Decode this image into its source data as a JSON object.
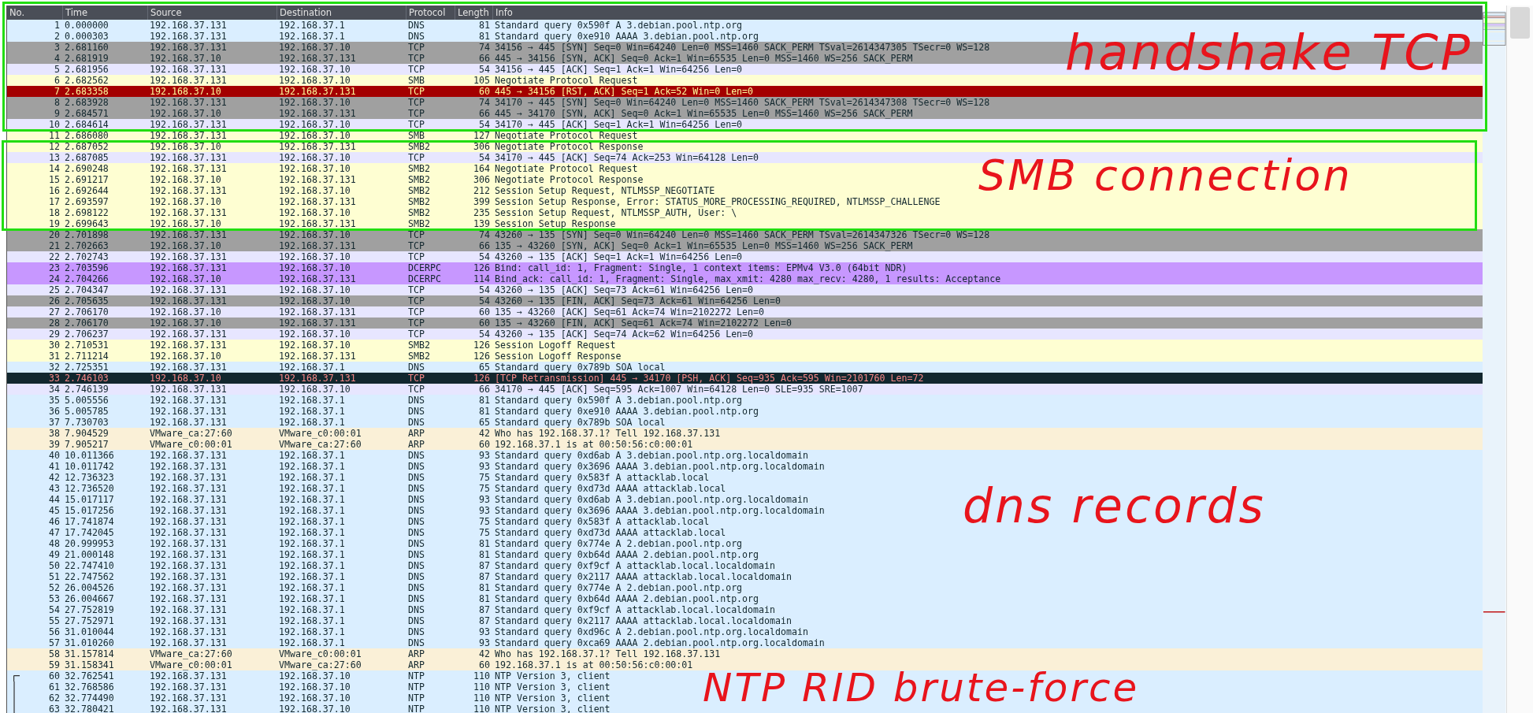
{
  "columns": [
    "No.",
    "Time",
    "Source",
    "Destination",
    "Protocol",
    "Length",
    "Info"
  ],
  "packets": [
    {
      "no": "1",
      "time": "0.000000",
      "source": "192.168.37.131",
      "destination": "192.168.37.1",
      "protocol": "DNS",
      "length": "81",
      "info": "Standard query 0x590f A 3.debian.pool.ntp.org",
      "kind": "udp",
      "related": false
    },
    {
      "no": "2",
      "time": "0.000303",
      "source": "192.168.37.131",
      "destination": "192.168.37.1",
      "protocol": "DNS",
      "length": "81",
      "info": "Standard query 0xe910 AAAA 3.debian.pool.ntp.org",
      "kind": "udp",
      "related": false
    },
    {
      "no": "3",
      "time": "2.681160",
      "source": "192.168.37.131",
      "destination": "192.168.37.10",
      "protocol": "TCP",
      "length": "74",
      "info": "34156 → 445 [SYN] Seq=0 Win=64240 Len=0 MSS=1460 SACK_PERM TSval=2614347305 TSecr=0 WS=128",
      "kind": "synfin",
      "related": false
    },
    {
      "no": "4",
      "time": "2.681919",
      "source": "192.168.37.10",
      "destination": "192.168.37.131",
      "protocol": "TCP",
      "length": "66",
      "info": "445 → 34156 [SYN, ACK] Seq=0 Ack=1 Win=65535 Len=0 MSS=1460 WS=256 SACK_PERM",
      "kind": "synfin",
      "related": false
    },
    {
      "no": "5",
      "time": "2.681956",
      "source": "192.168.37.131",
      "destination": "192.168.37.10",
      "protocol": "TCP",
      "length": "54",
      "info": "34156 → 445 [ACK] Seq=1 Ack=1 Win=64256 Len=0",
      "kind": "tcp",
      "related": false
    },
    {
      "no": "6",
      "time": "2.682562",
      "source": "192.168.37.131",
      "destination": "192.168.37.10",
      "protocol": "SMB",
      "length": "105",
      "info": "Negotiate Protocol Request",
      "kind": "smb",
      "related": false
    },
    {
      "no": "7",
      "time": "2.683358",
      "source": "192.168.37.10",
      "destination": "192.168.37.131",
      "protocol": "TCP",
      "length": "60",
      "info": "445 → 34156 [RST, ACK] Seq=1 Ack=52 Win=0 Len=0",
      "kind": "reset",
      "related": false
    },
    {
      "no": "8",
      "time": "2.683928",
      "source": "192.168.37.131",
      "destination": "192.168.37.10",
      "protocol": "TCP",
      "length": "74",
      "info": "34170 → 445 [SYN] Seq=0 Win=64240 Len=0 MSS=1460 SACK_PERM TSval=2614347308 TSecr=0 WS=128",
      "kind": "synfin",
      "related": false
    },
    {
      "no": "9",
      "time": "2.684571",
      "source": "192.168.37.10",
      "destination": "192.168.37.131",
      "protocol": "TCP",
      "length": "66",
      "info": "445 → 34170 [SYN, ACK] Seq=0 Ack=1 Win=65535 Len=0 MSS=1460 WS=256 SACK_PERM",
      "kind": "synfin",
      "related": false
    },
    {
      "no": "10",
      "time": "2.684614",
      "source": "192.168.37.131",
      "destination": "192.168.37.10",
      "protocol": "TCP",
      "length": "54",
      "info": "34170 → 445 [ACK] Seq=1 Ack=1 Win=64256 Len=0",
      "kind": "tcp",
      "related": false
    },
    {
      "no": "11",
      "time": "2.686080",
      "source": "192.168.37.131",
      "destination": "192.168.37.10",
      "protocol": "SMB",
      "length": "127",
      "info": "Negotiate Protocol Request",
      "kind": "smb",
      "related": false
    },
    {
      "no": "12",
      "time": "2.687052",
      "source": "192.168.37.10",
      "destination": "192.168.37.131",
      "protocol": "SMB2",
      "length": "306",
      "info": "Negotiate Protocol Response",
      "kind": "smb",
      "related": false
    },
    {
      "no": "13",
      "time": "2.687085",
      "source": "192.168.37.131",
      "destination": "192.168.37.10",
      "protocol": "TCP",
      "length": "54",
      "info": "34170 → 445 [ACK] Seq=74 Ack=253 Win=64128 Len=0",
      "kind": "tcp",
      "related": false
    },
    {
      "no": "14",
      "time": "2.690248",
      "source": "192.168.37.131",
      "destination": "192.168.37.10",
      "protocol": "SMB2",
      "length": "164",
      "info": "Negotiate Protocol Request",
      "kind": "smb",
      "related": false
    },
    {
      "no": "15",
      "time": "2.691217",
      "source": "192.168.37.10",
      "destination": "192.168.37.131",
      "protocol": "SMB2",
      "length": "306",
      "info": "Negotiate Protocol Response",
      "kind": "smb",
      "related": false
    },
    {
      "no": "16",
      "time": "2.692644",
      "source": "192.168.37.131",
      "destination": "192.168.37.10",
      "protocol": "SMB2",
      "length": "212",
      "info": "Session Setup Request, NTLMSSP_NEGOTIATE",
      "kind": "smb",
      "related": false
    },
    {
      "no": "17",
      "time": "2.693597",
      "source": "192.168.37.10",
      "destination": "192.168.37.131",
      "protocol": "SMB2",
      "length": "399",
      "info": "Session Setup Response, Error: STATUS_MORE_PROCESSING_REQUIRED, NTLMSSP_CHALLENGE",
      "kind": "smb",
      "related": false
    },
    {
      "no": "18",
      "time": "2.698122",
      "source": "192.168.37.131",
      "destination": "192.168.37.10",
      "protocol": "SMB2",
      "length": "235",
      "info": "Session Setup Request, NTLMSSP_AUTH, User: \\",
      "kind": "smb",
      "related": false
    },
    {
      "no": "19",
      "time": "2.699643",
      "source": "192.168.37.10",
      "destination": "192.168.37.131",
      "protocol": "SMB2",
      "length": "139",
      "info": "Session Setup Response",
      "kind": "smb",
      "related": false
    },
    {
      "no": "20",
      "time": "2.701898",
      "source": "192.168.37.131",
      "destination": "192.168.37.10",
      "protocol": "TCP",
      "length": "74",
      "info": "43260 → 135 [SYN] Seq=0 Win=64240 Len=0 MSS=1460 SACK_PERM TSval=2614347326 TSecr=0 WS=128",
      "kind": "synfin",
      "related": false
    },
    {
      "no": "21",
      "time": "2.702663",
      "source": "192.168.37.10",
      "destination": "192.168.37.131",
      "protocol": "TCP",
      "length": "66",
      "info": "135 → 43260 [SYN, ACK] Seq=0 Ack=1 Win=65535 Len=0 MSS=1460 WS=256 SACK_PERM",
      "kind": "synfin",
      "related": false
    },
    {
      "no": "22",
      "time": "2.702743",
      "source": "192.168.37.131",
      "destination": "192.168.37.10",
      "protocol": "TCP",
      "length": "54",
      "info": "43260 → 135 [ACK] Seq=1 Ack=1 Win=64256 Len=0",
      "kind": "tcp",
      "related": false
    },
    {
      "no": "23",
      "time": "2.703596",
      "source": "192.168.37.131",
      "destination": "192.168.37.10",
      "protocol": "DCERPC",
      "length": "126",
      "info": "Bind: call_id: 1, Fragment: Single, 1 context items: EPMv4 V3.0 (64bit NDR)",
      "kind": "dcerpc",
      "related": false
    },
    {
      "no": "24",
      "time": "2.704266",
      "source": "192.168.37.10",
      "destination": "192.168.37.131",
      "protocol": "DCERPC",
      "length": "114",
      "info": "Bind_ack: call_id: 1, Fragment: Single, max_xmit: 4280 max_recv: 4280, 1 results: Acceptance",
      "kind": "dcerpc",
      "related": false
    },
    {
      "no": "25",
      "time": "2.704347",
      "source": "192.168.37.131",
      "destination": "192.168.37.10",
      "protocol": "TCP",
      "length": "54",
      "info": "43260 → 135 [ACK] Seq=73 Ack=61 Win=64256 Len=0",
      "kind": "tcp",
      "related": false
    },
    {
      "no": "26",
      "time": "2.705635",
      "source": "192.168.37.131",
      "destination": "192.168.37.10",
      "protocol": "TCP",
      "length": "54",
      "info": "43260 → 135 [FIN, ACK] Seq=73 Ack=61 Win=64256 Len=0",
      "kind": "synfin",
      "related": false
    },
    {
      "no": "27",
      "time": "2.706170",
      "source": "192.168.37.10",
      "destination": "192.168.37.131",
      "protocol": "TCP",
      "length": "60",
      "info": "135 → 43260 [ACK] Seq=61 Ack=74 Win=2102272 Len=0",
      "kind": "tcp",
      "related": false
    },
    {
      "no": "28",
      "time": "2.706170",
      "source": "192.168.37.10",
      "destination": "192.168.37.131",
      "protocol": "TCP",
      "length": "60",
      "info": "135 → 43260 [FIN, ACK] Seq=61 Ack=74 Win=2102272 Len=0",
      "kind": "synfin",
      "related": false
    },
    {
      "no": "29",
      "time": "2.706237",
      "source": "192.168.37.131",
      "destination": "192.168.37.10",
      "protocol": "TCP",
      "length": "54",
      "info": "43260 → 135 [ACK] Seq=74 Ack=62 Win=64256 Len=0",
      "kind": "tcp",
      "related": false
    },
    {
      "no": "30",
      "time": "2.710531",
      "source": "192.168.37.131",
      "destination": "192.168.37.10",
      "protocol": "SMB2",
      "length": "126",
      "info": "Session Logoff Request",
      "kind": "smb",
      "related": false
    },
    {
      "no": "31",
      "time": "2.711214",
      "source": "192.168.37.10",
      "destination": "192.168.37.131",
      "protocol": "SMB2",
      "length": "126",
      "info": "Session Logoff Response",
      "kind": "smb",
      "related": false
    },
    {
      "no": "32",
      "time": "2.725351",
      "source": "192.168.37.131",
      "destination": "192.168.37.1",
      "protocol": "DNS",
      "length": "65",
      "info": "Standard query 0x789b SOA local",
      "kind": "udp",
      "related": false
    },
    {
      "no": "33",
      "time": "2.746103",
      "source": "192.168.37.10",
      "destination": "192.168.37.131",
      "protocol": "TCP",
      "length": "126",
      "info": "[TCP Retransmission] 445 → 34170 [PSH, ACK] Seq=935 Ack=595 Win=2101760 Len=72",
      "kind": "retransmission",
      "related": false
    },
    {
      "no": "34",
      "time": "2.746139",
      "source": "192.168.37.131",
      "destination": "192.168.37.10",
      "protocol": "TCP",
      "length": "66",
      "info": "34170 → 445 [ACK] Seq=595 Ack=1007 Win=64128 Len=0 SLE=935 SRE=1007",
      "kind": "tcp",
      "related": false
    },
    {
      "no": "35",
      "time": "5.005556",
      "source": "192.168.37.131",
      "destination": "192.168.37.1",
      "protocol": "DNS",
      "length": "81",
      "info": "Standard query 0x590f A 3.debian.pool.ntp.org",
      "kind": "udp",
      "related": false
    },
    {
      "no": "36",
      "time": "5.005785",
      "source": "192.168.37.131",
      "destination": "192.168.37.1",
      "protocol": "DNS",
      "length": "81",
      "info": "Standard query 0xe910 AAAA 3.debian.pool.ntp.org",
      "kind": "udp",
      "related": false
    },
    {
      "no": "37",
      "time": "7.730703",
      "source": "192.168.37.131",
      "destination": "192.168.37.1",
      "protocol": "DNS",
      "length": "65",
      "info": "Standard query 0x789b SOA local",
      "kind": "udp",
      "related": false
    },
    {
      "no": "38",
      "time": "7.904529",
      "source": "VMware_ca:27:60",
      "destination": "VMware_c0:00:01",
      "protocol": "ARP",
      "length": "42",
      "info": "Who has 192.168.37.1? Tell 192.168.37.131",
      "kind": "arp",
      "related": false
    },
    {
      "no": "39",
      "time": "7.905217",
      "source": "VMware_c0:00:01",
      "destination": "VMware_ca:27:60",
      "protocol": "ARP",
      "length": "60",
      "info": "192.168.37.1 is at 00:50:56:c0:00:01",
      "kind": "arp",
      "related": false
    },
    {
      "no": "40",
      "time": "10.011366",
      "source": "192.168.37.131",
      "destination": "192.168.37.1",
      "protocol": "DNS",
      "length": "93",
      "info": "Standard query 0xd6ab A 3.debian.pool.ntp.org.localdomain",
      "kind": "udp",
      "related": false
    },
    {
      "no": "41",
      "time": "10.011742",
      "source": "192.168.37.131",
      "destination": "192.168.37.1",
      "protocol": "DNS",
      "length": "93",
      "info": "Standard query 0x3696 AAAA 3.debian.pool.ntp.org.localdomain",
      "kind": "udp",
      "related": false
    },
    {
      "no": "42",
      "time": "12.736323",
      "source": "192.168.37.131",
      "destination": "192.168.37.1",
      "protocol": "DNS",
      "length": "75",
      "info": "Standard query 0x583f A attacklab.local",
      "kind": "udp",
      "related": false
    },
    {
      "no": "43",
      "time": "12.736520",
      "source": "192.168.37.131",
      "destination": "192.168.37.1",
      "protocol": "DNS",
      "length": "75",
      "info": "Standard query 0xd73d AAAA attacklab.local",
      "kind": "udp",
      "related": false
    },
    {
      "no": "44",
      "time": "15.017117",
      "source": "192.168.37.131",
      "destination": "192.168.37.1",
      "protocol": "DNS",
      "length": "93",
      "info": "Standard query 0xd6ab A 3.debian.pool.ntp.org.localdomain",
      "kind": "udp",
      "related": false
    },
    {
      "no": "45",
      "time": "15.017256",
      "source": "192.168.37.131",
      "destination": "192.168.37.1",
      "protocol": "DNS",
      "length": "93",
      "info": "Standard query 0x3696 AAAA 3.debian.pool.ntp.org.localdomain",
      "kind": "udp",
      "related": false
    },
    {
      "no": "46",
      "time": "17.741874",
      "source": "192.168.37.131",
      "destination": "192.168.37.1",
      "protocol": "DNS",
      "length": "75",
      "info": "Standard query 0x583f A attacklab.local",
      "kind": "udp",
      "related": false
    },
    {
      "no": "47",
      "time": "17.742045",
      "source": "192.168.37.131",
      "destination": "192.168.37.1",
      "protocol": "DNS",
      "length": "75",
      "info": "Standard query 0xd73d AAAA attacklab.local",
      "kind": "udp",
      "related": false
    },
    {
      "no": "48",
      "time": "20.999953",
      "source": "192.168.37.131",
      "destination": "192.168.37.1",
      "protocol": "DNS",
      "length": "81",
      "info": "Standard query 0x774e A 2.debian.pool.ntp.org",
      "kind": "udp",
      "related": false
    },
    {
      "no": "49",
      "time": "21.000148",
      "source": "192.168.37.131",
      "destination": "192.168.37.1",
      "protocol": "DNS",
      "length": "81",
      "info": "Standard query 0xb64d AAAA 2.debian.pool.ntp.org",
      "kind": "udp",
      "related": false
    },
    {
      "no": "50",
      "time": "22.747410",
      "source": "192.168.37.131",
      "destination": "192.168.37.1",
      "protocol": "DNS",
      "length": "87",
      "info": "Standard query 0xf9cf A attacklab.local.localdomain",
      "kind": "udp",
      "related": false
    },
    {
      "no": "51",
      "time": "22.747562",
      "source": "192.168.37.131",
      "destination": "192.168.37.1",
      "protocol": "DNS",
      "length": "87",
      "info": "Standard query 0x2117 AAAA attacklab.local.localdomain",
      "kind": "udp",
      "related": false
    },
    {
      "no": "52",
      "time": "26.004526",
      "source": "192.168.37.131",
      "destination": "192.168.37.1",
      "protocol": "DNS",
      "length": "81",
      "info": "Standard query 0x774e A 2.debian.pool.ntp.org",
      "kind": "udp",
      "related": false
    },
    {
      "no": "53",
      "time": "26.004667",
      "source": "192.168.37.131",
      "destination": "192.168.37.1",
      "protocol": "DNS",
      "length": "81",
      "info": "Standard query 0xb64d AAAA 2.debian.pool.ntp.org",
      "kind": "udp",
      "related": false
    },
    {
      "no": "54",
      "time": "27.752819",
      "source": "192.168.37.131",
      "destination": "192.168.37.1",
      "protocol": "DNS",
      "length": "87",
      "info": "Standard query 0xf9cf A attacklab.local.localdomain",
      "kind": "udp",
      "related": false
    },
    {
      "no": "55",
      "time": "27.752971",
      "source": "192.168.37.131",
      "destination": "192.168.37.1",
      "protocol": "DNS",
      "length": "87",
      "info": "Standard query 0x2117 AAAA attacklab.local.localdomain",
      "kind": "udp",
      "related": false
    },
    {
      "no": "56",
      "time": "31.010044",
      "source": "192.168.37.131",
      "destination": "192.168.37.1",
      "protocol": "DNS",
      "length": "93",
      "info": "Standard query 0xd96c A 2.debian.pool.ntp.org.localdomain",
      "kind": "udp",
      "related": false
    },
    {
      "no": "57",
      "time": "31.010260",
      "source": "192.168.37.131",
      "destination": "192.168.37.1",
      "protocol": "DNS",
      "length": "93",
      "info": "Standard query 0xca69 AAAA 2.debian.pool.ntp.org.localdomain",
      "kind": "udp",
      "related": false
    },
    {
      "no": "58",
      "time": "31.157814",
      "source": "VMware_ca:27:60",
      "destination": "VMware_c0:00:01",
      "protocol": "ARP",
      "length": "42",
      "info": "Who has 192.168.37.1? Tell 192.168.37.131",
      "kind": "arp",
      "related": false
    },
    {
      "no": "59",
      "time": "31.158341",
      "source": "VMware_c0:00:01",
      "destination": "VMware_ca:27:60",
      "protocol": "ARP",
      "length": "60",
      "info": "192.168.37.1 is at 00:50:56:c0:00:01",
      "kind": "arp",
      "related": false
    },
    {
      "no": "60",
      "time": "32.762541",
      "source": "192.168.37.131",
      "destination": "192.168.37.10",
      "protocol": "NTP",
      "length": "110",
      "info": "NTP Version 3, client",
      "kind": "udp",
      "related": true
    },
    {
      "no": "61",
      "time": "32.768586",
      "source": "192.168.37.131",
      "destination": "192.168.37.10",
      "protocol": "NTP",
      "length": "110",
      "info": "NTP Version 3, client",
      "kind": "udp",
      "related": true
    },
    {
      "no": "62",
      "time": "32.774490",
      "source": "192.168.37.131",
      "destination": "192.168.37.10",
      "protocol": "NTP",
      "length": "110",
      "info": "NTP Version 3, client",
      "kind": "udp",
      "related": true
    },
    {
      "no": "63",
      "time": "32.780421",
      "source": "192.168.37.131",
      "destination": "192.168.37.10",
      "protocol": "NTP",
      "length": "110",
      "info": "NTP Version 3, client",
      "kind": "udp",
      "related": true
    }
  ],
  "annotations": [
    "handshake TCP",
    "SMB connection",
    "dns records",
    "NTP RID brute-force"
  ]
}
